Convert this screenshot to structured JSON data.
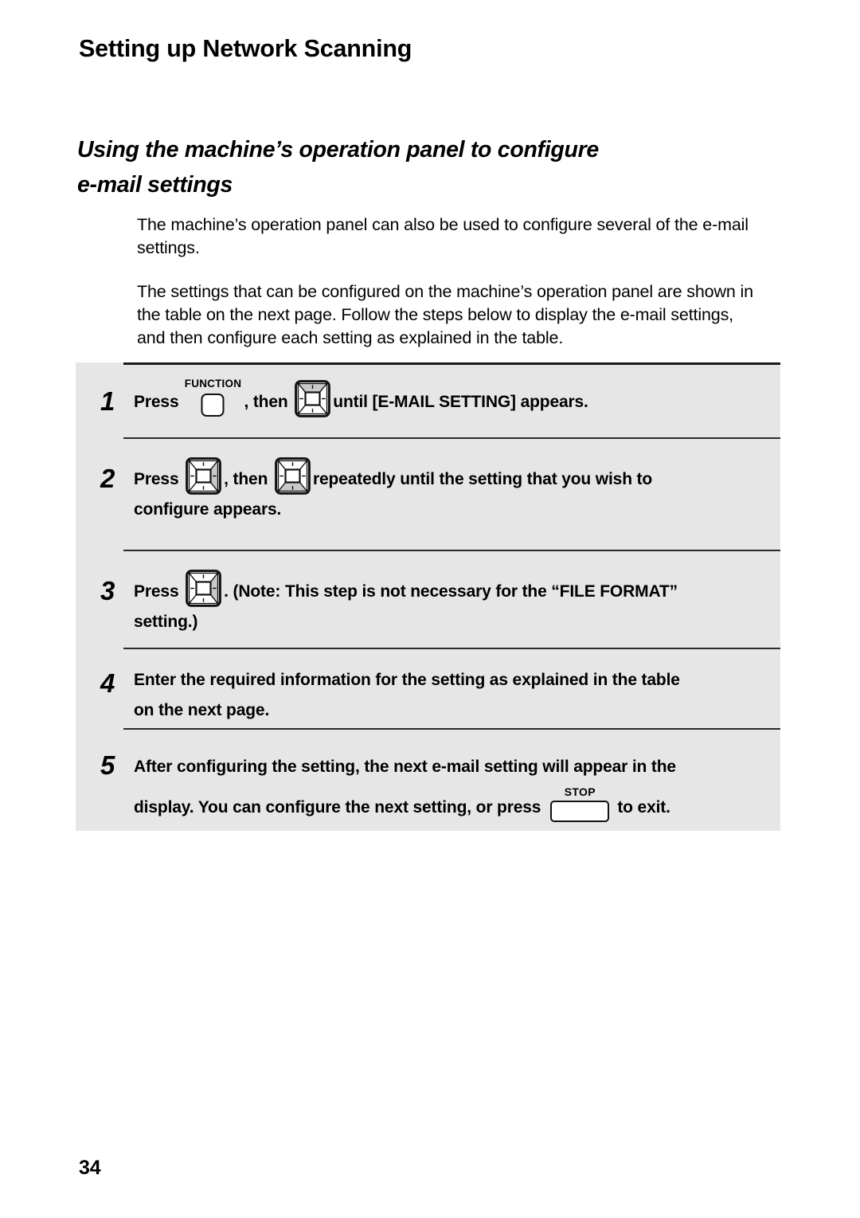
{
  "document": {
    "chapter_title": "Setting up Network Scanning",
    "section_title_line1": "Using the machine’s operation panel to configure",
    "section_title_line2": "e-mail settings",
    "page_number": "34"
  },
  "intro": {
    "paragraph_1": "The machine’s operation panel can also be used to configure several of the e-mail settings.",
    "paragraph_2": "The settings that can be configured on the machine’s operation panel are shown in the table on the next page. Follow the steps below to display the e-mail settings, and then configure each setting as explained in the table."
  },
  "steps": [
    {
      "number": "1",
      "text_before_key1": "Press",
      "key1": {
        "type": "labeled-key",
        "label": "FUNCTION"
      },
      "text_between": ", then",
      "key2": {
        "type": "arrow-pad",
        "highlight": "up"
      },
      "text_after": "until [E-MAIL SETTING] appears."
    },
    {
      "number": "2",
      "text_before_key1": "Press",
      "key1": {
        "type": "arrow-pad",
        "highlight": "right"
      },
      "text_between": ", then",
      "key2": {
        "type": "arrow-pad",
        "highlight": "down"
      },
      "text_after": "repeatedly until the setting that you wish to",
      "text_line2": "configure appears."
    },
    {
      "number": "3",
      "text_before_key1": "Press",
      "key1": {
        "type": "arrow-pad",
        "highlight": "right"
      },
      "text_after": ". (Note: This step is not necessary for the “FILE FORMAT”",
      "text_line2": "setting.)"
    },
    {
      "number": "4",
      "text_after": "Enter the required information for the setting as explained in the table",
      "text_line2": "on the next page."
    },
    {
      "number": "5",
      "text_after": "After configuring the setting, the next e-mail setting will appear in the",
      "text_line2_before_key": "display. You can configure the next setting, or press",
      "key_stop": {
        "type": "labeled-key",
        "label": "STOP"
      },
      "text_line2_after_key": "to exit."
    }
  ],
  "colors": {
    "panel_background": "#e6e6e6",
    "page_background": "#ffffff",
    "ink": "#000000",
    "key_shade": "#cccccc"
  }
}
